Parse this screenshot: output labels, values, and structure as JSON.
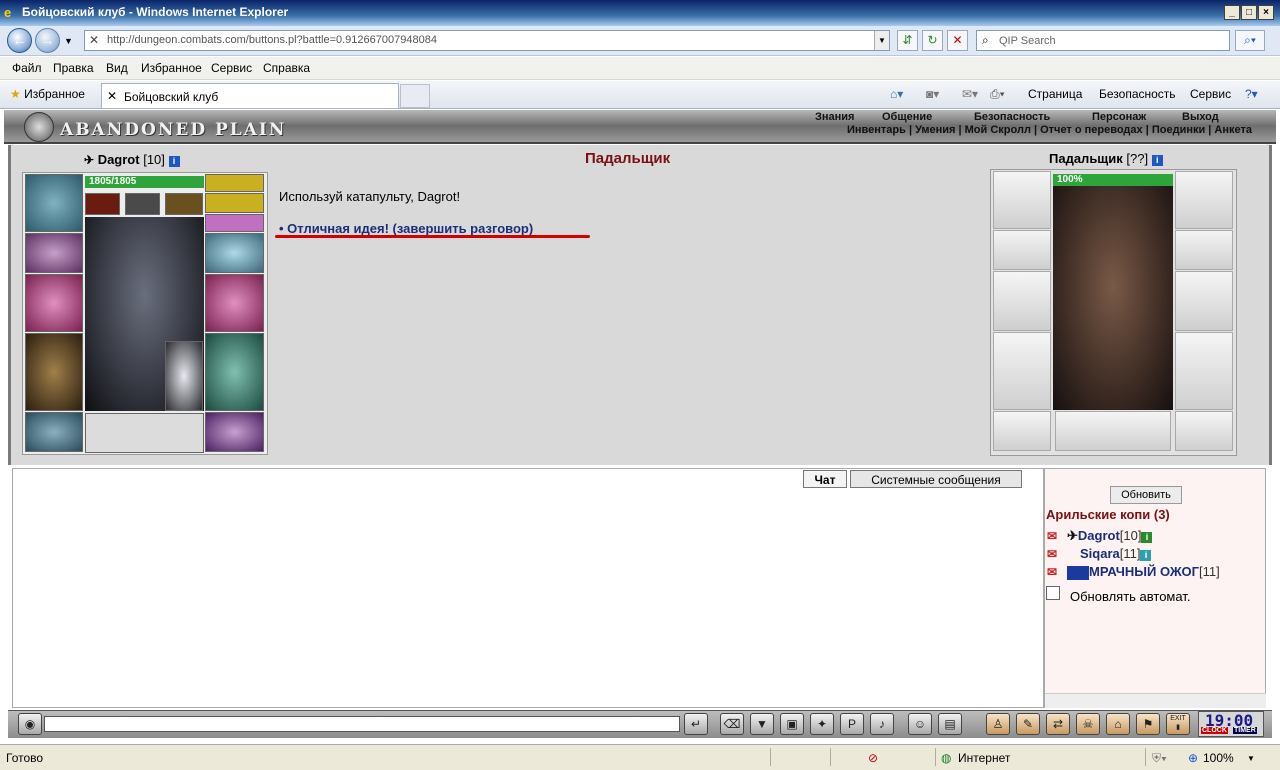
{
  "window": {
    "title": "Бойцовский клуб - Windows Internet Explorer"
  },
  "address": {
    "url": "http://dungeon.combats.com/buttons.pl?battle=0.912667007948084"
  },
  "search": {
    "placeholder": "QIP Search"
  },
  "menu": [
    "Файл",
    "Правка",
    "Вид",
    "Избранное",
    "Сервис",
    "Справка"
  ],
  "favbar": {
    "favorites_label": "Избранное",
    "tab_title": "Бойцовский клуб",
    "commands": [
      "Страница",
      "Безопасность",
      "Сервис"
    ]
  },
  "game_header": {
    "logo": "ABANDONED PLAIN",
    "top_links": [
      "Знания",
      "Общение",
      "Безопасность",
      "Персонаж",
      "Выход"
    ],
    "sub_links": "Инвентарь | Умения | Мой Скролл | Отчет о переводах | Поединки | Анкета"
  },
  "player": {
    "name": "Dagrot",
    "level": "[10]",
    "hp": "1805/1805"
  },
  "dialog": {
    "npc_title": "Падальщик",
    "text": "Используй катапульту, Dagrot!",
    "reply": "• Отличная идея! (завершить разговор)"
  },
  "npc": {
    "name": "Падальщик",
    "level": "[??]",
    "hp": "100%"
  },
  "chat_tabs": [
    "Чат",
    "Системные сообщения"
  ],
  "online": {
    "refresh_label": "Обновить",
    "location": "Арильские копи (3)",
    "users": [
      {
        "name": "Dagrot",
        "level": "[10]"
      },
      {
        "name": "Siqara",
        "level": "[11]"
      },
      {
        "name": "МРАЧНЫЙ ОЖОГ",
        "level": "[11]"
      }
    ],
    "auto_refresh_label": "Обновлять автомат."
  },
  "clock": {
    "time": "19:00",
    "label_clock": "CLOCK",
    "label_timer": "TIMER",
    "exit": "EXIT"
  },
  "status": {
    "text": "Готово",
    "zone": "Интернет",
    "zoom": "100%"
  },
  "colors": {
    "dialog_title": "#7a1010",
    "reply_link": "#1c2e7a",
    "underline": "#d40000",
    "hp": "#2ea43a"
  }
}
